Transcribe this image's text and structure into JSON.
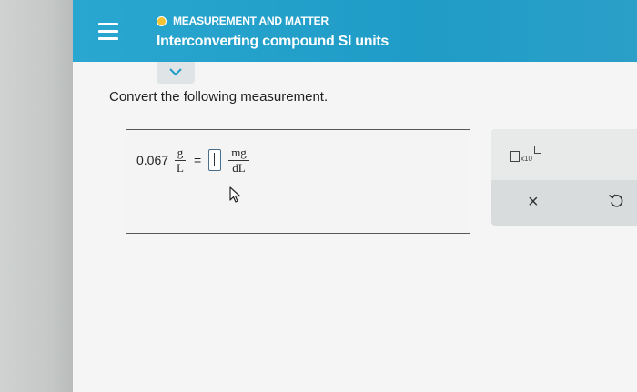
{
  "header": {
    "topic": "MEASUREMENT AND MATTER",
    "title": "Interconverting compound SI units",
    "topic_dot_color": "#f1c232",
    "accent": "#1f9cc7"
  },
  "question": {
    "prompt": "Convert the following measurement.",
    "given_value": "0.067",
    "given_unit_numerator": "g",
    "given_unit_denominator": "L",
    "equals": "=",
    "answer_value": "",
    "target_unit_numerator": "mg",
    "target_unit_denominator": "dL"
  },
  "tools": {
    "sci_notation_label": "x10",
    "clear_label": "×",
    "icons": [
      "scientific-notation-icon",
      "clear-icon",
      "undo-icon"
    ]
  }
}
